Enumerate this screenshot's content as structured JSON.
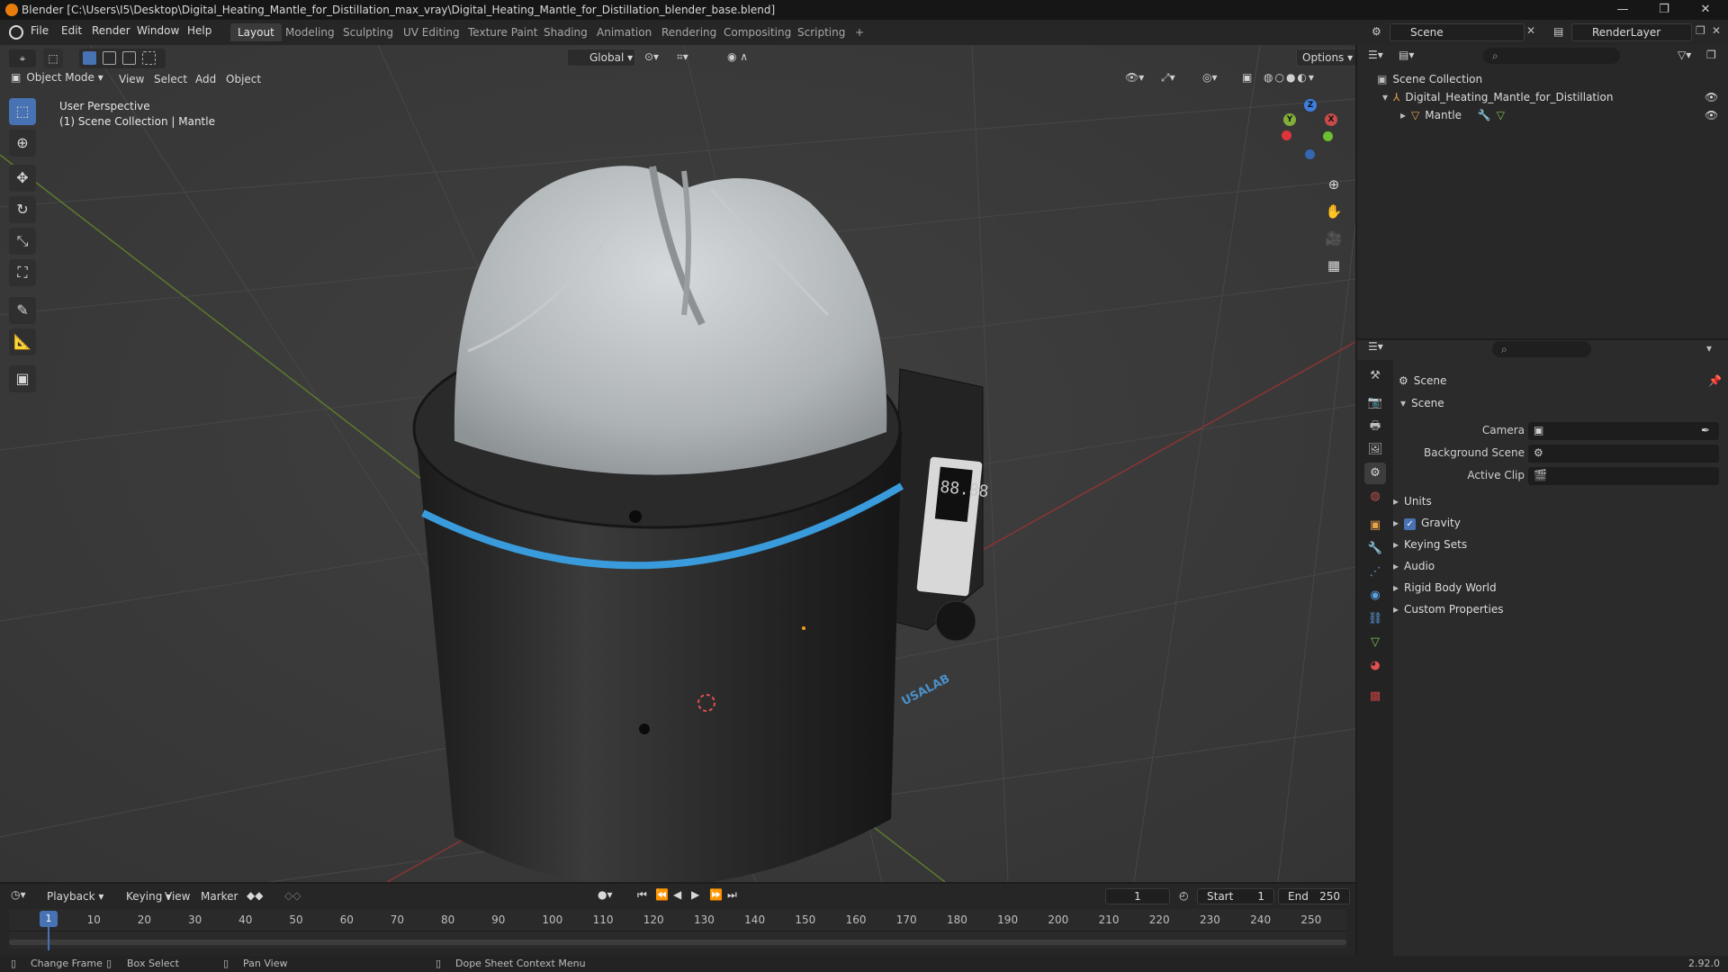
{
  "window": {
    "title": "Blender [C:\\Users\\I5\\Desktop\\Digital_Heating_Mantle_for_Distillation_max_vray\\Digital_Heating_Mantle_for_Distillation_blender_base.blend]",
    "minimize": "—",
    "maximize": "❐",
    "close": "✕"
  },
  "menu": {
    "items": [
      "File",
      "Edit",
      "Render",
      "Window",
      "Help"
    ],
    "workspaces": [
      "Layout",
      "Modeling",
      "Sculpting",
      "UV Editing",
      "Texture Paint",
      "Shading",
      "Animation",
      "Rendering",
      "Compositing",
      "Scripting"
    ],
    "add_workspace": "+",
    "scene": "Scene",
    "render_layer": "RenderLayer"
  },
  "viewport": {
    "mode": "Object Mode",
    "menus": [
      "View",
      "Select",
      "Add",
      "Object"
    ],
    "orientation": "Global",
    "options": "Options",
    "perspective": "User Perspective",
    "collection_info": "(1) Scene Collection | Mantle",
    "gizmo": {
      "z": "Z",
      "y": "Y",
      "x": "X"
    },
    "device_display": "88.88",
    "brand": "USALAB"
  },
  "outliner": {
    "root": "Scene Collection",
    "items": [
      {
        "label": "Digital_Heating_Mantle_for_Distillation"
      },
      {
        "label": "Mantle"
      }
    ]
  },
  "properties": {
    "header": "Scene",
    "section": "Scene",
    "fields": [
      {
        "label": "Camera"
      },
      {
        "label": "Background Scene"
      },
      {
        "label": "Active Clip"
      }
    ],
    "panels": [
      "Units",
      "Gravity",
      "Keying Sets",
      "Audio",
      "Rigid Body World",
      "Custom Properties"
    ],
    "gravity_checked": true
  },
  "timeline": {
    "menus": [
      "Playback",
      "Keying",
      "View",
      "Marker"
    ],
    "current_frame": "1",
    "start_label": "Start",
    "start": "1",
    "end_label": "End",
    "end": "250",
    "ticks": [
      "1",
      "10",
      "20",
      "30",
      "40",
      "50",
      "60",
      "70",
      "80",
      "90",
      "100",
      "110",
      "120",
      "130",
      "140",
      "150",
      "160",
      "170",
      "180",
      "190",
      "200",
      "210",
      "220",
      "230",
      "240",
      "250"
    ]
  },
  "status": {
    "change_frame": "Change Frame",
    "box_select": "Box Select",
    "pan_view": "Pan View",
    "context_menu": "Dope Sheet Context Menu",
    "version": "2.92.0"
  },
  "colors": {
    "accent": "#4772b3",
    "blender_orange": "#e87d0d",
    "axis_x": "#c84a4a",
    "axis_y": "#7fae39",
    "stripe_blue": "#3a9bdc"
  }
}
